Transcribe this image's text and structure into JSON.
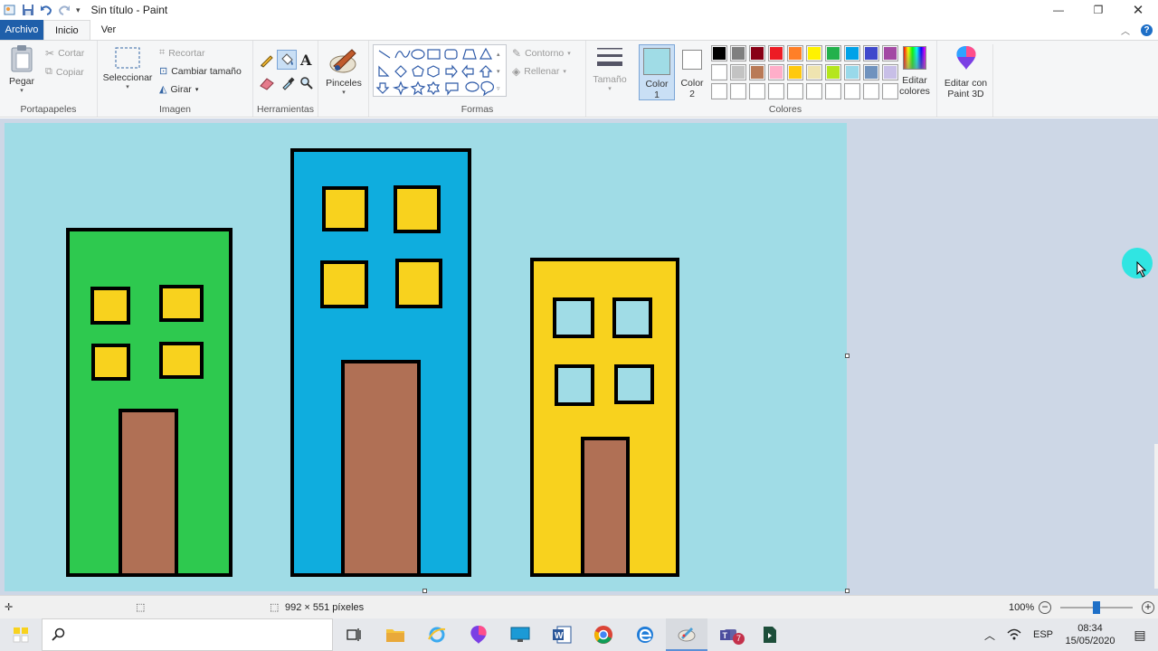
{
  "window": {
    "title": "Sin título - Paint"
  },
  "menu": {
    "file": "Archivo",
    "tabs": [
      "Inicio",
      "Ver"
    ]
  },
  "ribbon": {
    "clipboard": {
      "label": "Portapapeles",
      "paste": "Pegar",
      "cut": "Cortar",
      "copy": "Copiar"
    },
    "image": {
      "label": "Imagen",
      "select": "Seleccionar",
      "crop": "Recortar",
      "resize": "Cambiar tamaño",
      "rotate": "Girar"
    },
    "tools": {
      "label": "Herramientas"
    },
    "brushes": {
      "label": "Pinceles"
    },
    "shapes": {
      "label": "Formas",
      "outline": "Contorno",
      "fill": "Rellenar"
    },
    "size": {
      "label": "Tamaño"
    },
    "color1": {
      "label": "Color",
      "num": "1",
      "color": "#a0dce6"
    },
    "color2": {
      "label": "Color",
      "num": "2",
      "color": "#ffffff"
    },
    "colors": {
      "label": "Colores",
      "row1": [
        "#000000",
        "#7f7f7f",
        "#880015",
        "#ed1c24",
        "#ff7f27",
        "#fff200",
        "#22b14c",
        "#00a2e8",
        "#3f48cc",
        "#a349a4"
      ],
      "row2": [
        "#ffffff",
        "#c3c3c3",
        "#b97a57",
        "#ffaec9",
        "#ffc90e",
        "#efe4b0",
        "#b5e61d",
        "#99d9ea",
        "#7092be",
        "#c8bfe7"
      ],
      "row3": [
        "#ffffff",
        "#ffffff",
        "#ffffff",
        "#ffffff",
        "#ffffff",
        "#ffffff",
        "#ffffff",
        "#ffffff",
        "#ffffff",
        "#ffffff"
      ]
    },
    "edit_colors": {
      "line1": "Editar",
      "line2": "colores"
    },
    "paint3d": {
      "line1": "Editar con",
      "line2": "Paint 3D"
    }
  },
  "drawing": {
    "background": "#a0dce6",
    "buildings": [
      {
        "name": "green",
        "color": "#2ec94f"
      },
      {
        "name": "blue",
        "color": "#0fadde"
      },
      {
        "name": "yellow",
        "color": "#f8d21e"
      }
    ],
    "window_color": "#f8d21e",
    "door_color": "#b07055"
  },
  "status": {
    "dimensions": "992 × 551 píxeles",
    "zoom": "100%"
  },
  "taskbar": {
    "lang": "ESP",
    "time": "08:34",
    "date": "15/05/2020",
    "teams_badge": "7"
  }
}
